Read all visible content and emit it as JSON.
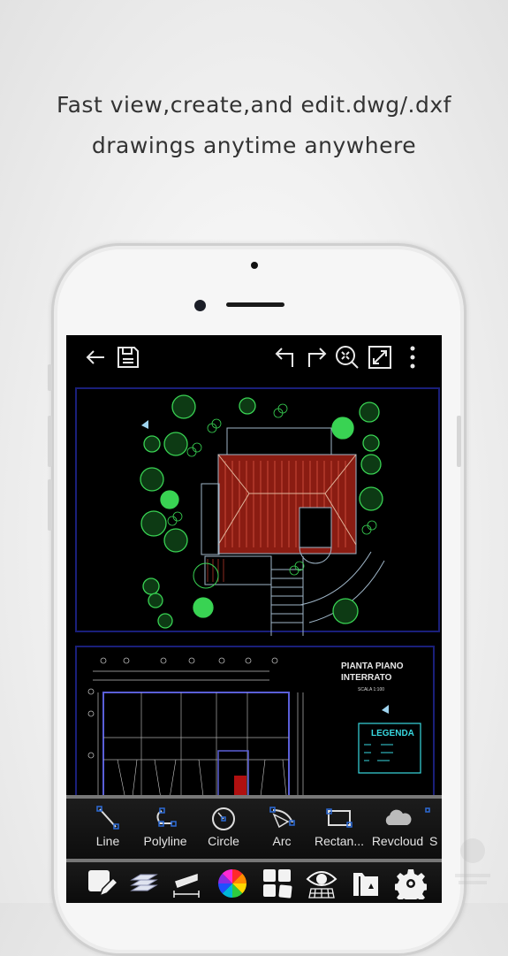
{
  "headline": {
    "line1": "Fast view,create,and edit.dwg/.dxf",
    "line2": "drawings anytime anywhere"
  },
  "app": {
    "toolbar_icons": [
      "back-arrow-icon",
      "save-icon",
      "undo-icon",
      "redo-icon",
      "zoom-extents-icon",
      "fullscreen-icon",
      "more-vertical-icon"
    ],
    "drawing": {
      "sheet2_title_line1": "PIANTA PIANO",
      "sheet2_title_line2": "INTERRATO",
      "sheet2_scale": "SCALA 1:100",
      "legend_title": "LEGENDA"
    },
    "draw_tools": [
      {
        "label": "Line",
        "icon": "line-tool-icon"
      },
      {
        "label": "Polyline",
        "icon": "polyline-tool-icon"
      },
      {
        "label": "Circle",
        "icon": "circle-tool-icon"
      },
      {
        "label": "Arc",
        "icon": "arc-tool-icon"
      },
      {
        "label": "Rectan...",
        "icon": "rectangle-tool-icon"
      },
      {
        "label": "Revcloud",
        "icon": "revcloud-tool-icon"
      },
      {
        "label": "S",
        "icon": "partial-tool-icon"
      }
    ],
    "utility_tools": [
      "edit-pencil-icon",
      "layers-icon",
      "measure-ruler-icon",
      "color-wheel-icon",
      "blocks-icon",
      "view-grid-eye-icon",
      "file-folder-icon",
      "settings-gear-icon"
    ],
    "colors": {
      "screen_bg": "#000000",
      "tool_accent": "#2d6bd6",
      "tree_green": "#39d353",
      "roof_red": "#8a1c12",
      "sheet_border": "#1a1f7a",
      "legend_cyan": "#38d8e0"
    }
  }
}
